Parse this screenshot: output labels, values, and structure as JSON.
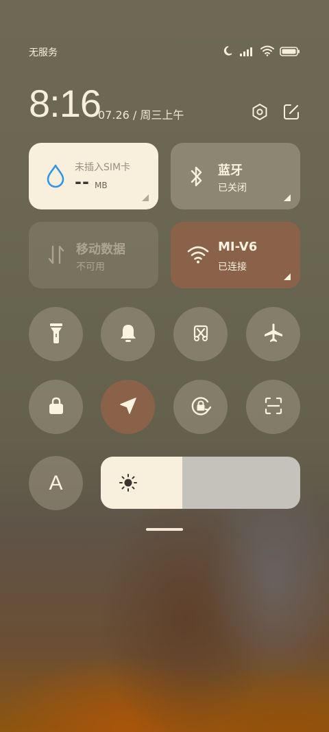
{
  "status_bar": {
    "carrier": "无服务",
    "icons": [
      "moon-icon",
      "signal-bars-icon",
      "wifi-icon",
      "battery-icon"
    ]
  },
  "header": {
    "time": "8:16",
    "date": "07.26 / 周三上午",
    "actions": [
      "settings-icon",
      "edit-icon"
    ]
  },
  "tiles": {
    "data_usage": {
      "label": "未插入SIM卡",
      "value": "--",
      "unit": "MB",
      "icon": "water-drop-icon"
    },
    "bluetooth": {
      "title": "蓝牙",
      "subtitle": "已关闭",
      "icon": "bluetooth-icon"
    },
    "mobile_data": {
      "title": "移动数据",
      "subtitle": "不可用",
      "icon": "data-arrows-icon"
    },
    "wifi": {
      "title": "MI-V6",
      "subtitle": "已连接",
      "icon": "wifi-icon"
    }
  },
  "toggles_row1": [
    "flashlight-icon",
    "bell-icon",
    "screenshot-icon",
    "airplane-icon"
  ],
  "toggles_row2": [
    "lock-icon",
    "location-icon",
    "rotation-lock-icon",
    "scan-icon"
  ],
  "auto_brightness": {
    "label": "A"
  },
  "brightness": {
    "level": 0.41,
    "icon": "sun-icon"
  },
  "colors": {
    "tile_light": "#f8efdc",
    "tile_active": "#8a6149",
    "accent_blue": "#2f95e6",
    "text_light": "#f7efdc"
  }
}
